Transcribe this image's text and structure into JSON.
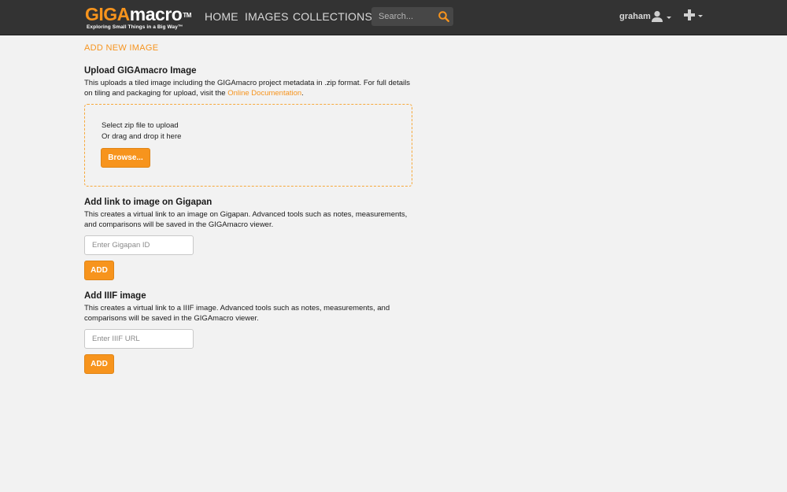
{
  "header": {
    "logo": {
      "brand_part1": "GIGA",
      "brand_part2": "macro",
      "trademark": "TM",
      "tagline": "Exploring Small Things in a Big Way™"
    },
    "nav": {
      "home": "HOME",
      "images": "IMAGES",
      "collections": "COLLECTIONS"
    },
    "search": {
      "placeholder": "Search...",
      "icon": "search-icon"
    },
    "user": {
      "name": "graham",
      "icon": "user-icon",
      "caret_icon": "caret-down-icon"
    },
    "add_menu": {
      "icon": "plus-icon",
      "caret_icon": "caret-down-icon"
    }
  },
  "page": {
    "title": "ADD NEW IMAGE"
  },
  "upload_section": {
    "title": "Upload GIGAmacro Image",
    "description_before_link": "This uploads a tiled image including the GIGAmacro project metadata in .zip format. For full details on tiling and packaging for upload, visit the ",
    "link_text": "Online Documentation",
    "description_after_link": ".",
    "dropzone_line1": "Select zip file to upload",
    "dropzone_line2": "Or drag and drop it here",
    "browse_label": "Browse..."
  },
  "gigapan_section": {
    "title": "Add link to image on Gigapan",
    "description": "This creates a virtual link to an image on Gigapan. Advanced tools such as notes, measurements, and comparisons will be saved in the GIGAmacro viewer.",
    "input_placeholder": "Enter Gigapan ID",
    "input_value": "",
    "button_label": "ADD"
  },
  "iiif_section": {
    "title": "Add IIIF image",
    "description": "This creates a virtual link to a IIIF image. Advanced tools such as notes, measurements, and comparisons will be saved in the GIGAmacro viewer.",
    "input_placeholder": "Enter IIIF URL",
    "input_value": "",
    "button_label": "ADD"
  },
  "colors": {
    "accent": "#f7941d",
    "nav_background": "#333333",
    "page_background": "#f2f2f2",
    "nav_text": "#d9d9d9"
  }
}
